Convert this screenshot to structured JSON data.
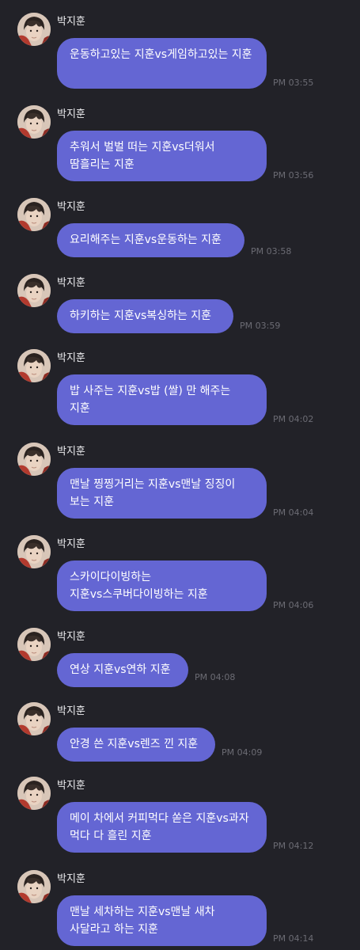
{
  "sender": "박지훈",
  "messages": [
    {
      "text": "운동하고있는 지훈vs게임하고있는 지훈",
      "time": "PM 03:55"
    },
    {
      "text": "추워서 벌벌 떠는 지훈vs더워서 땀흘리는 지훈",
      "time": "PM 03:56"
    },
    {
      "text": "요리해주는 지훈vs운동하는 지훈",
      "time": "PM 03:58"
    },
    {
      "text": "하키하는 지훈vs복싱하는 지훈",
      "time": "PM 03:59"
    },
    {
      "text": "밥 사주는 지훈vs밥 (쌀) 만 해주는 지훈",
      "time": "PM 04:02"
    },
    {
      "text": "맨날 찡찡거리는 지훈vs맨날 징징이 보는 지훈",
      "time": "PM 04:04"
    },
    {
      "text": "스카이다이빙하는 지훈vs스쿠버다이빙하는 지훈",
      "time": "PM 04:06"
    },
    {
      "text": "연상 지훈vs연하 지훈",
      "time": "PM 04:08"
    },
    {
      "text": "안경 쓴 지훈vs렌즈 낀 지훈",
      "time": "PM 04:09"
    },
    {
      "text": "메이 차에서 커피먹다 쏟은 지훈vs과자 먹다 다 흘린 지훈",
      "time": "PM 04:12"
    },
    {
      "text": "맨날 세차하는 지훈vs맨날 새차 사달라고 하는 지훈",
      "time": "PM 04:14"
    }
  ]
}
